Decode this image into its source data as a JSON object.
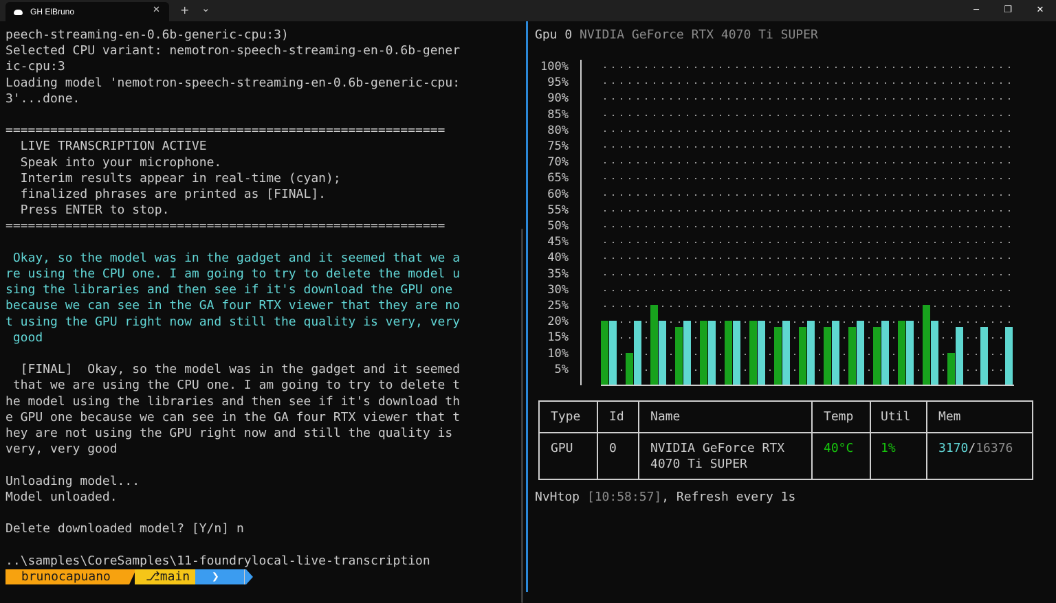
{
  "titlebar": {
    "tab_title": "GH ElBruno",
    "tab_close": "✕",
    "new_tab": "+",
    "dropdown": "⌄",
    "minimize": "─",
    "maximize": "❐",
    "close": "✕"
  },
  "left": {
    "lines": [
      "peech-streaming-en-0.6b-generic-cpu:3)",
      "Selected CPU variant: nemotron-speech-streaming-en-0.6b-gener",
      "ic-cpu:3",
      "Loading model 'nemotron-speech-streaming-en-0.6b-generic-cpu:",
      "3'...done.",
      "",
      "===========================================================",
      "  LIVE TRANSCRIPTION ACTIVE",
      "  Speak into your microphone.",
      "  Interim results appear in real-time (cyan);",
      "  finalized phrases are printed as [FINAL].",
      "  Press ENTER to stop.",
      "===========================================================",
      "",
      " Okay, so the model was in the gadget and it seemed that we a",
      "re using the CPU one. I am going to try to delete the model u",
      "sing the libraries and then see if it's download the GPU one",
      "because we can see in the GA four RTX viewer that they are no",
      "t using the GPU right now and still the quality is very, very",
      " good",
      "",
      "  [FINAL]  Okay, so the model was in the gadget and it seemed",
      " that we are using the CPU one. I am going to try to delete t",
      "he model using the libraries and then see if it's download th",
      "e GPU one because we can see in the GA four RTX viewer that t",
      "hey are not using the GPU right now and still the quality is",
      "very, very good",
      "",
      "Unloading model...",
      "Model unloaded.",
      "",
      "Delete downloaded model? [Y/n] n",
      "",
      "..\\samples\\CoreSamples\\11-foundrylocal-live-transcription"
    ],
    "prompt": {
      "user": " brunocapuano ",
      "branch": "⎇main ",
      "arrow": "❯",
      "colors": {
        "user": "#f7a20f",
        "branch": "#f5c518",
        "arrow": "#3b9cf0"
      }
    }
  },
  "right": {
    "gpu_label": "Gpu 0",
    "gpu_name": "NVIDIA GeForce RTX 4070 Ti SUPER",
    "chart_data": {
      "type": "bar",
      "y_ticks": [
        "100%",
        "95%",
        "90%",
        "85%",
        "80%",
        "75%",
        "70%",
        "65%",
        "60%",
        "55%",
        "50%",
        "45%",
        "40%",
        "35%",
        "30%",
        "25%",
        "20%",
        "15%",
        "10%",
        "5%"
      ],
      "ylim": [
        0,
        100
      ],
      "series": [
        {
          "color": "#18a21d",
          "values": [
            20,
            10,
            25,
            18,
            20,
            20,
            20,
            18,
            18,
            18,
            18,
            18,
            20,
            25,
            10,
            0,
            0
          ]
        },
        {
          "color": "#5fd7d0",
          "values": [
            20,
            20,
            20,
            20,
            20,
            20,
            20,
            20,
            20,
            20,
            20,
            20,
            20,
            20,
            18,
            18,
            18
          ]
        }
      ]
    },
    "table": {
      "headers": {
        "type": "Type",
        "id": "Id",
        "name": "Name",
        "temp": "Temp",
        "util": "Util",
        "mem": "Mem"
      },
      "row": {
        "type": "GPU",
        "id": "0",
        "name_line1": "NVIDIA GeForce RTX",
        "name_line2": "4070 Ti SUPER",
        "temp": "40°C",
        "util": "1%",
        "mem_used": "3170",
        "mem_sep": "/",
        "mem_total": "16376"
      }
    },
    "status": {
      "app": "NvHtop",
      "time": "[10:58:57]",
      "refresh": ", Refresh every 1s"
    },
    "colors": {
      "accent_green": "#16c60c",
      "accent_cyan": "#61d6d6",
      "dim": "#8c8c8c"
    }
  }
}
